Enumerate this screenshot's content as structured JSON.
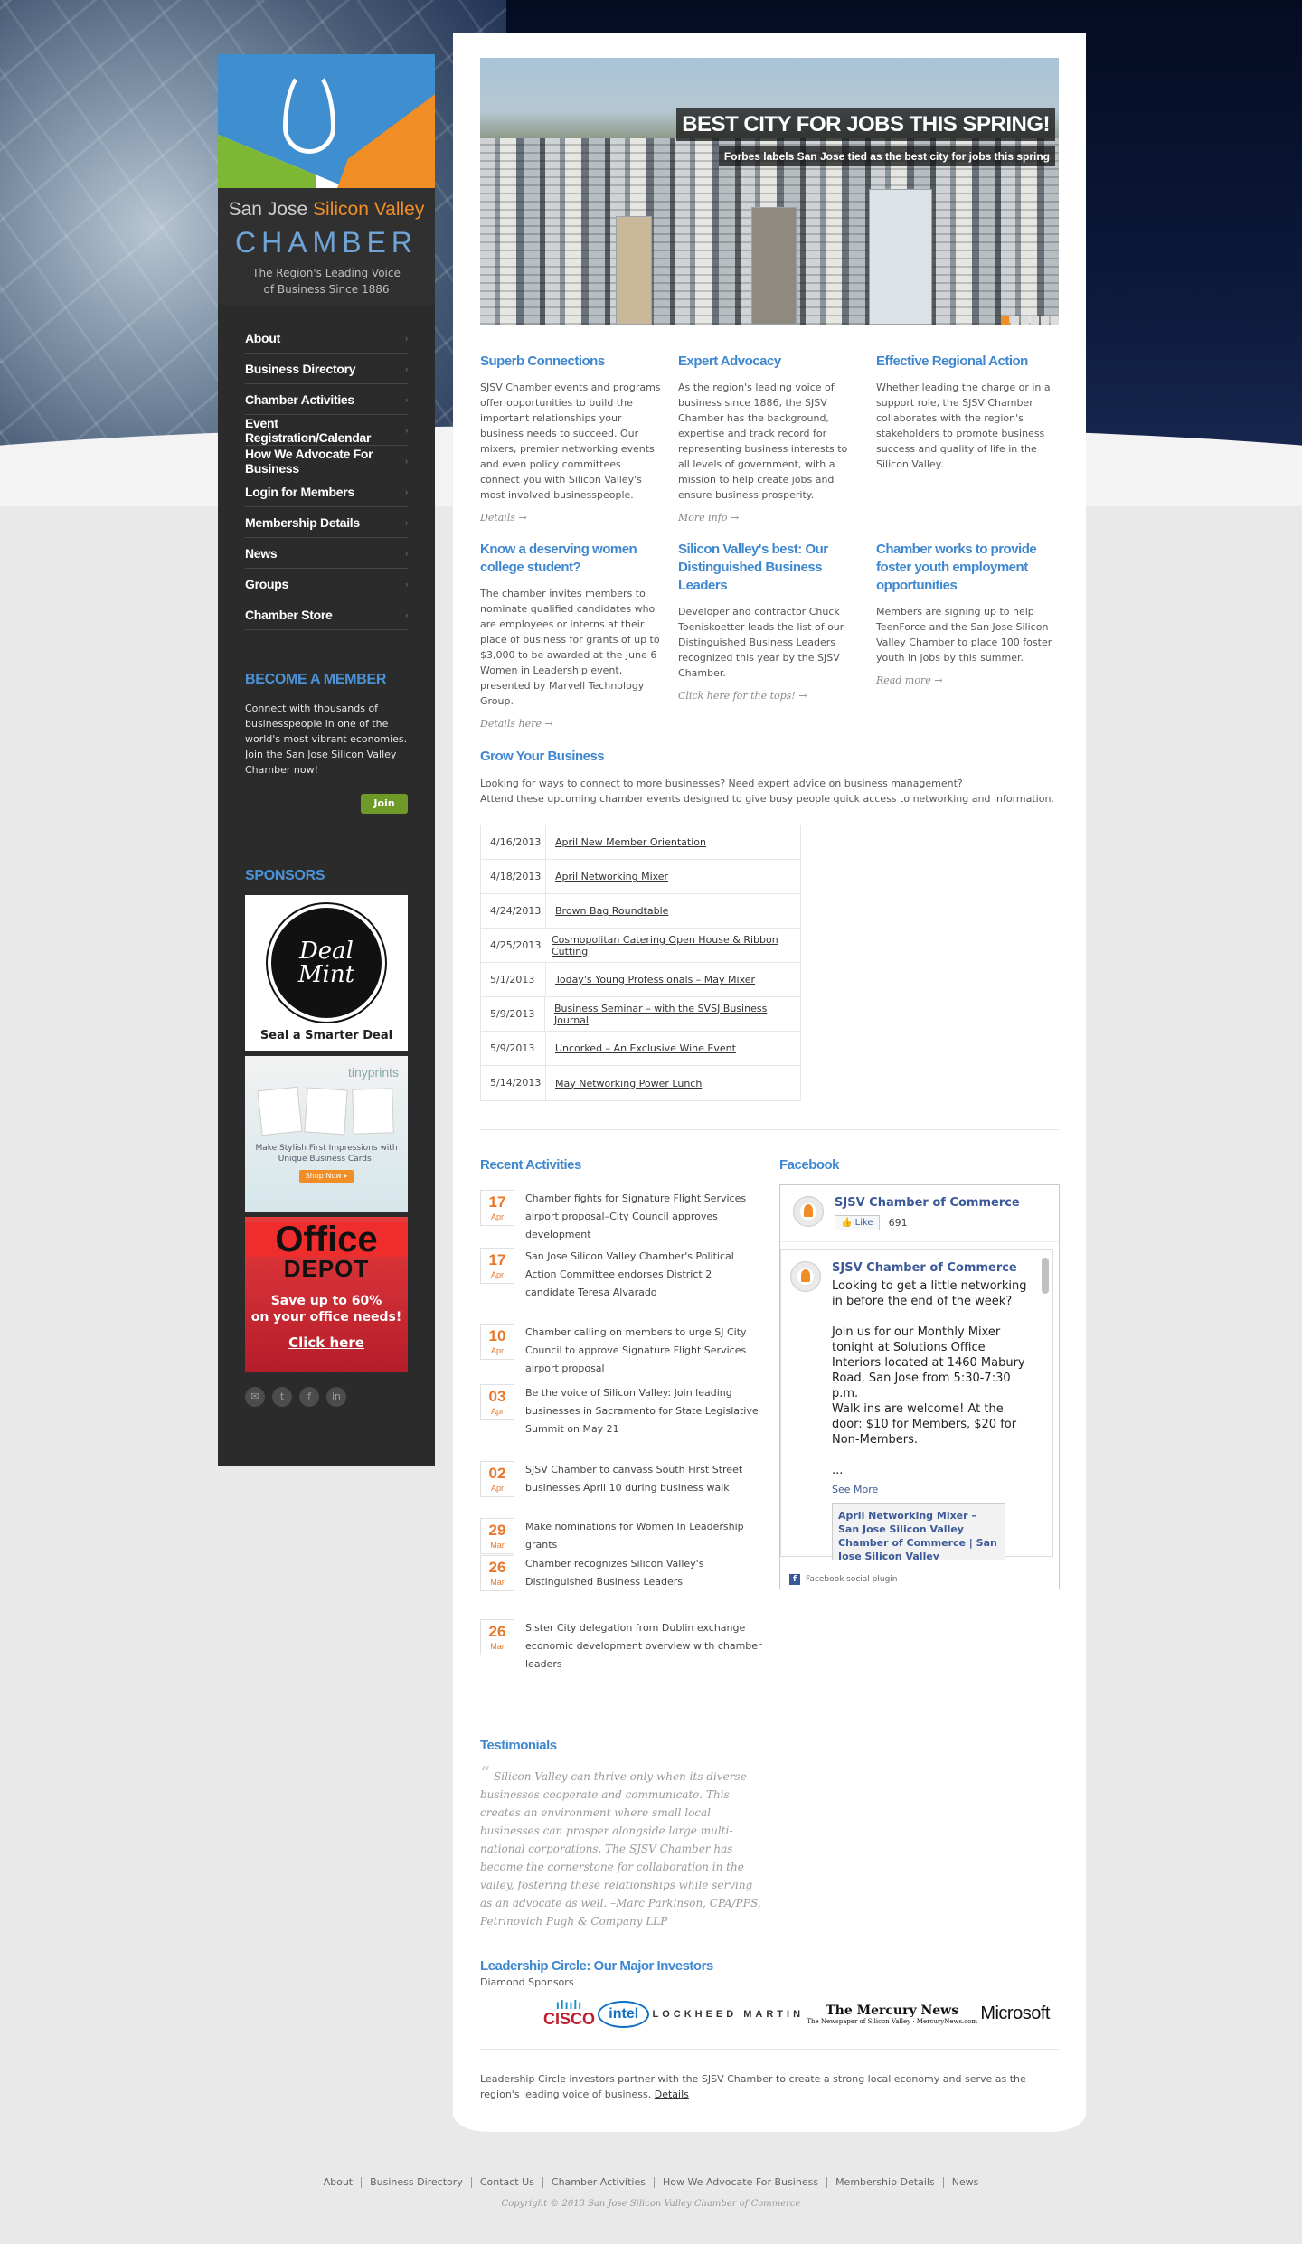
{
  "colors": {
    "accent_blue": "#3f88cf",
    "accent_orange": "#f08e25",
    "sidebar_bg": "#2b2b2b",
    "join_green": "#6f9a28"
  },
  "logo": {
    "line1_a": "San Jose ",
    "line1_b": "Silicon Valley",
    "line2": "CHAMBER",
    "tagline1": "The Region's Leading Voice",
    "tagline2": "of Business Since 1886"
  },
  "nav": [
    "About",
    "Business Directory",
    "Chamber Activities",
    "Event Registration/Calendar",
    "How We Advocate For Business",
    "Login for Members",
    "Membership Details",
    "News",
    "Groups",
    "Chamber Store"
  ],
  "member": {
    "title": "BECOME A MEMBER",
    "text": "Connect with thousands of businesspeople in one of the world's most vibrant economies. Join the San Jose Silicon Valley Chamber now!",
    "join": "Join"
  },
  "sponsors": {
    "title": "SPONSORS",
    "dealmint_l1": "Deal",
    "dealmint_l2": "Mint",
    "dealmint_caption": "Seal a Smarter Deal",
    "tiny_logo": "tinyprints",
    "tiny_text": "Make Stylish First Impressions with Unique Business Cards!",
    "tiny_btn": "Shop Now ▸",
    "od_l1": "Office",
    "od_l2": "DEPOT",
    "od_l3a": "Save up to 60%",
    "od_l3b": "on your office needs!",
    "od_l4": "Click here"
  },
  "social_icons": [
    "email-icon",
    "twitter-icon",
    "facebook-icon",
    "linkedin-icon"
  ],
  "hero": {
    "title": "BEST CITY FOR JOBS THIS SPRING!",
    "subtitle": "Forbes labels San Jose tied as the best city for jobs this spring",
    "slides": 6,
    "active_slide": 1
  },
  "features": [
    {
      "title": "Superb Connections",
      "text": "SJSV Chamber events and programs offer opportunities to build the important relationships your business needs to succeed. Our mixers, premier networking events and even policy committees connect you with Silicon Valley's most involved businesspeople.",
      "link": "Details →"
    },
    {
      "title": "Expert Advocacy",
      "text": "As the region's leading voice of business since 1886, the SJSV Chamber has the background, expertise and track record for representing business interests to all levels of government, with a mission to help create jobs and ensure business prosperity.",
      "link": "More info →"
    },
    {
      "title": "Effective Regional Action",
      "text": "Whether leading the charge or in a support role, the SJSV Chamber collaborates with the region's stakeholders to promote business success and quality of life in the Silicon Valley.",
      "link": ""
    }
  ],
  "news": [
    {
      "title": "Know a deserving women college student?",
      "text": "The chamber invites members to nominate qualified candidates who are employees or interns at their place of business for grants of up to $3,000 to be awarded at the June 6 Women in Leadership event, presented by Marvell Technology Group.",
      "link": "Details here →"
    },
    {
      "title": "Silicon Valley's best: Our Distinguished Business Leaders",
      "text": "Developer and contractor Chuck Toeniskoetter leads the list of our Distinguished Business Leaders recognized this year by the SJSV Chamber.",
      "link": "Click here for the tops! →"
    },
    {
      "title": "Chamber works to provide foster youth employment opportunities",
      "text": "Members are signing up to help TeenForce and the San Jose Silicon Valley Chamber to place 100 foster youth in jobs by this summer.",
      "link": "Read more →"
    }
  ],
  "grow": {
    "title": "Grow Your Business",
    "line1": "Looking for ways to connect to more businesses? Need expert advice on business management?",
    "line2": "Attend these upcoming chamber events designed to give busy people quick access to networking and information."
  },
  "events": [
    {
      "date": "4/16/2013",
      "title": "April New Member Orientation"
    },
    {
      "date": "4/18/2013",
      "title": "April Networking Mixer"
    },
    {
      "date": "4/24/2013",
      "title": "Brown Bag Roundtable"
    },
    {
      "date": "4/25/2013",
      "title": "Cosmopolitan Catering Open House & Ribbon Cutting"
    },
    {
      "date": "5/1/2013",
      "title": "Today's Young Professionals – May Mixer"
    },
    {
      "date": "5/9/2013",
      "title": "Business Seminar – with the SVSJ Business Journal"
    },
    {
      "date": "5/9/2013",
      "title": "Uncorked – An Exclusive Wine Event"
    },
    {
      "date": "5/14/2013",
      "title": "May Networking Power Lunch"
    }
  ],
  "activities_title": "Recent Activities",
  "activities": [
    {
      "day": "17",
      "mon": "Apr",
      "text": "Chamber fights for Signature Flight Services airport proposal–City Council approves development"
    },
    {
      "day": "17",
      "mon": "Apr",
      "text": "San Jose Silicon Valley Chamber's Political Action Committee endorses District 2 candidate Teresa Alvarado"
    },
    {
      "day": "10",
      "mon": "Apr",
      "text": "Chamber calling on members to urge SJ City Council to approve Signature Flight Services airport proposal"
    },
    {
      "day": "03",
      "mon": "Apr",
      "text": "Be the voice of Silicon Valley: Join leading businesses in Sacramento for State Legislative Summit on May 21"
    },
    {
      "day": "02",
      "mon": "Apr",
      "text": "SJSV Chamber to canvass South First Street businesses April 10 during business walk"
    },
    {
      "day": "29",
      "mon": "Mar",
      "text": "Make nominations for Women In Leadership grants"
    },
    {
      "day": "26",
      "mon": "Mar",
      "text": "Chamber recognizes Silicon Valley's Distinguished Business Leaders"
    },
    {
      "day": "26",
      "mon": "Mar",
      "text": "Sister City delegation from Dublin exchange economic development overview with chamber leaders"
    }
  ],
  "facebook": {
    "title": "Facebook",
    "page_name": "SJSV Chamber of Commerce",
    "like": "Like",
    "likes": "691",
    "post_name": "SJSV Chamber of Commerce",
    "post_text": "Looking to get a little networking in before the end of the week?\n\nJoin us for our Monthly Mixer tonight at Solutions Office Interiors located at 1460 Mabury Road, San Jose from 5:30-7:30 p.m.\nWalk ins are welcome! At the door: $10 for Members, $20 for Non-Members.\n\n...",
    "see_more": "See More",
    "attachment": "April Networking Mixer – San Jose Silicon Valley Chamber of Commerce | San Jose Silicon Valley",
    "plugin": "Facebook social plugin"
  },
  "testimonials": {
    "title": "Testimonials",
    "quote": "Silicon Valley can thrive only when its diverse businesses cooperate and communicate. This creates an environment where small local businesses can prosper alongside large multi-national corporations. The SJSV Chamber has become the cornerstone for collaboration in the valley, fostering these relationships while serving as an advocate as well. –Marc Parkinson, CPA/PFS, Petrinovich Pugh & Company LLP"
  },
  "leadership": {
    "title": "Leadership Circle: Our Major Investors",
    "subtitle": "Diamond Sponsors",
    "logos": {
      "cisco": "CISCO",
      "intel": "intel",
      "lockheed": "LOCKHEED MARTIN",
      "merc": "The Mercury News",
      "merc_sub": "The Newspaper of Silicon Valley · MercuryNews.com",
      "ms": "Microsoft"
    },
    "footer": "Leadership Circle investors partner with the SJSV Chamber to create a strong local economy and serve as the region's leading voice of business.",
    "details": "Details"
  },
  "footer": {
    "links": [
      "About",
      "Business Directory",
      "Contact Us",
      "Chamber Activities",
      "How We Advocate For Business",
      "Membership Details",
      "News"
    ],
    "copyright": "Copyright © 2013 San Jose Silicon Valley Chamber of Commerce"
  }
}
